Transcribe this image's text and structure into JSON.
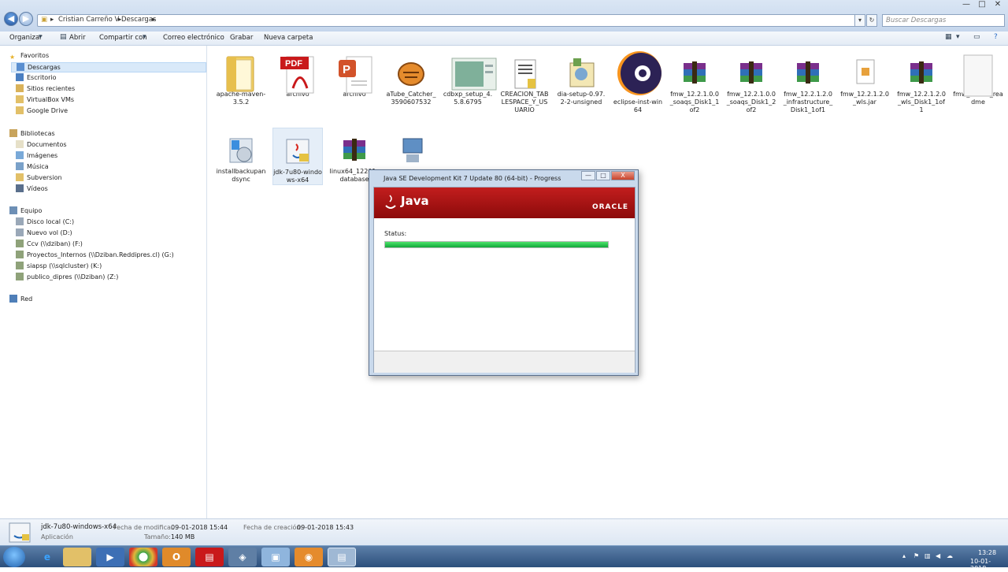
{
  "breadcrumb": [
    "Cristian Carreño V",
    "Descargas"
  ],
  "search": {
    "placeholder": "Buscar Descargas"
  },
  "toolbar": {
    "organize": "Organizar",
    "open": "Abrir",
    "share": "Compartir con",
    "email": "Correo electrónico",
    "burn": "Grabar",
    "new_folder": "Nueva carpeta"
  },
  "sidebar": {
    "favorites": "Favoritos",
    "fav_items": [
      "Descargas",
      "Escritorio",
      "Sitios recientes",
      "VirtualBox VMs",
      "Google Drive"
    ],
    "libraries": "Bibliotecas",
    "lib_items": [
      "Documentos",
      "Imágenes",
      "Música",
      "Subversion",
      "Vídeos"
    ],
    "computer": "Equipo",
    "comp_items": [
      "Disco local (C:)",
      "Nuevo vol (D:)",
      "Ccv (\\\\dziban) (F:)",
      "Proyectos_Internos (\\\\Dziban.Reddipres.cl) (G:)",
      "siapsp (\\\\sqlcluster) (K:)",
      "publico_dipres (\\\\Dziban) (Z:)"
    ],
    "network": "Red"
  },
  "files": [
    {
      "name": "apache-maven-3.5.2",
      "icon": "folder-icon"
    },
    {
      "name": "archivo",
      "icon": "pdf-icon"
    },
    {
      "name": "archivo",
      "icon": "powerpoint-icon"
    },
    {
      "name": "aTube_Catcher_3590607532",
      "icon": "atube-icon"
    },
    {
      "name": "cdbxp_setup_4.5.8.6795",
      "icon": "installer-icon"
    },
    {
      "name": "CREACION_TABLESPACE_Y_USUARIO",
      "icon": "text-file-icon"
    },
    {
      "name": "dia-setup-0.97.2-2-unsigned",
      "icon": "setup-icon"
    },
    {
      "name": "eclipse-inst-win64",
      "icon": "eclipse-icon"
    },
    {
      "name": "fmw_12.2.1.0.0_soaqs_Disk1_1of2",
      "icon": "rar-icon"
    },
    {
      "name": "fmw_12.2.1.0.0_soaqs_Disk1_2of2",
      "icon": "rar-icon"
    },
    {
      "name": "fmw_12.2.1.2.0_infrastructure_Disk1_1of1",
      "icon": "rar-icon"
    },
    {
      "name": "fmw_12.2.1.2.0_wls.jar",
      "icon": "jar-icon"
    },
    {
      "name": "fmw_12.2.1.2.0_wls_Disk1_1of1",
      "icon": "rar-icon"
    },
    {
      "name": "fmw_12212_readme",
      "icon": "blank-file-icon"
    },
    {
      "name": "installbackupandsync",
      "icon": "backup-sync-icon"
    },
    {
      "name": "jdk-7u80-windows-x64",
      "icon": "java-installer-icon"
    },
    {
      "name": "linux64_12201_database",
      "icon": "rar-icon"
    },
    {
      "name": "",
      "icon": "setup-computer-icon"
    }
  ],
  "dialog": {
    "title": "Java SE Development Kit 7 Update 80 (64-bit) - Progress",
    "logo_text": "Java",
    "brand": "ORACLE",
    "status_label": "Status:",
    "progress": 1.0,
    "minimize": "—",
    "maximize": "□",
    "close": "X"
  },
  "details": {
    "name": "jdk-7u80-windows-x64",
    "type": "Aplicación",
    "modified_label": "Fecha de modifica...",
    "modified": "09-01-2018 15:44",
    "created_label": "Fecha de creación:",
    "created": "09-01-2018 15:43",
    "size_label": "Tamaño:",
    "size": "140 MB"
  },
  "taskbar": {
    "time": "13:28",
    "date": "10-01-2018"
  },
  "colors": {
    "java_red": "#b01515",
    "progress_green": "#22c14a",
    "selection": "#d9e9f9"
  }
}
